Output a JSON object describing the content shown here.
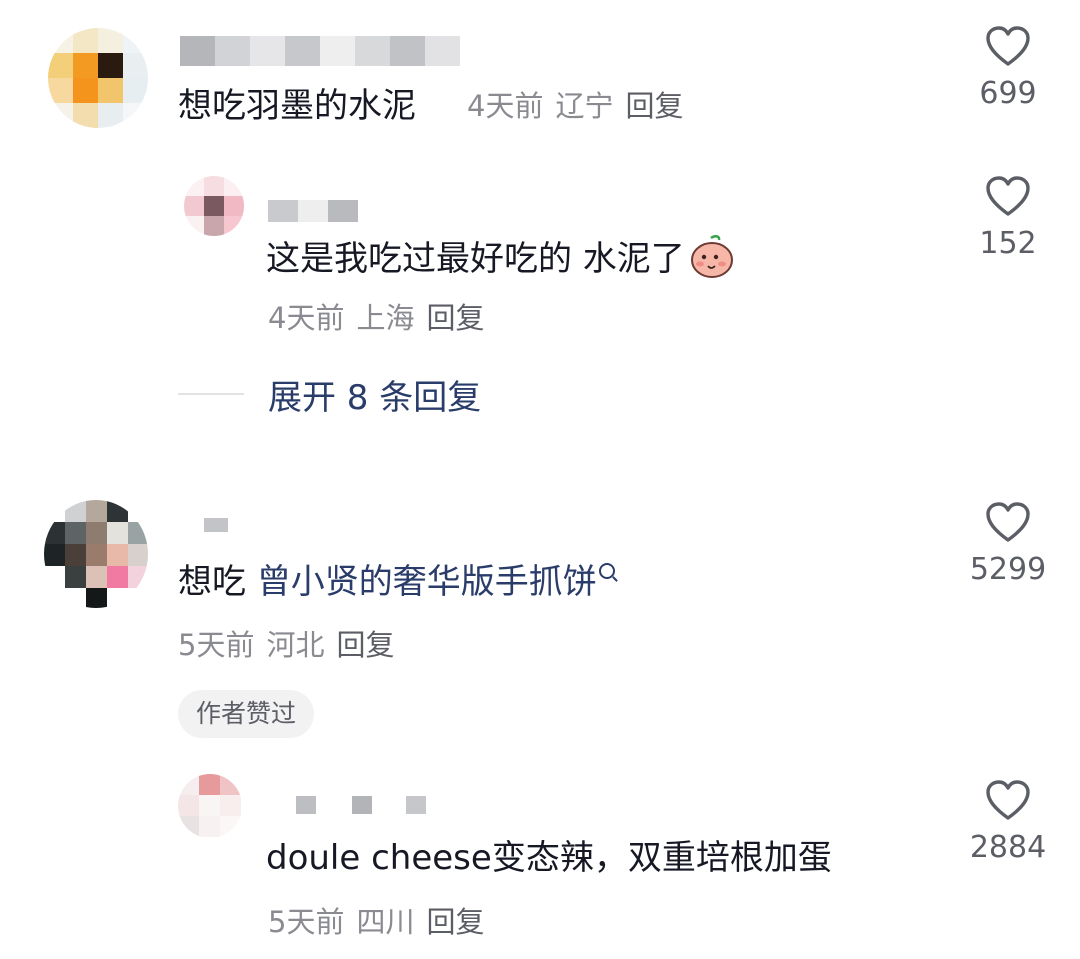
{
  "comments": [
    {
      "text": "想吃羽墨的水泥",
      "time": "4天前",
      "location": "辽宁",
      "reply": "回复",
      "likes": "699"
    },
    {
      "text_prefix": "想吃",
      "text_link": "曾小贤的奢华版手抓饼",
      "time": "5天前",
      "location": "河北",
      "reply": "回复",
      "likes": "5299",
      "badge": "作者赞过"
    }
  ],
  "replies": [
    {
      "text": "这是我吃过最好吃的 水泥了",
      "emoji": "blushing-peach-emoji",
      "time": "4天前",
      "location": "上海",
      "reply": "回复",
      "likes": "152"
    },
    {
      "text": "doule cheese变态辣，双重培根加蛋",
      "time": "5天前",
      "location": "四川",
      "reply": "回复",
      "likes": "2884"
    }
  ],
  "expand": {
    "label": "展开 8 条回复"
  },
  "icons": {
    "like": "heart-outline-icon",
    "search": "search-icon"
  },
  "colors": {
    "text": "#161823",
    "meta": "#8a8b91",
    "link": "#2a3c6a",
    "badge_bg": "#f2f2f3"
  }
}
